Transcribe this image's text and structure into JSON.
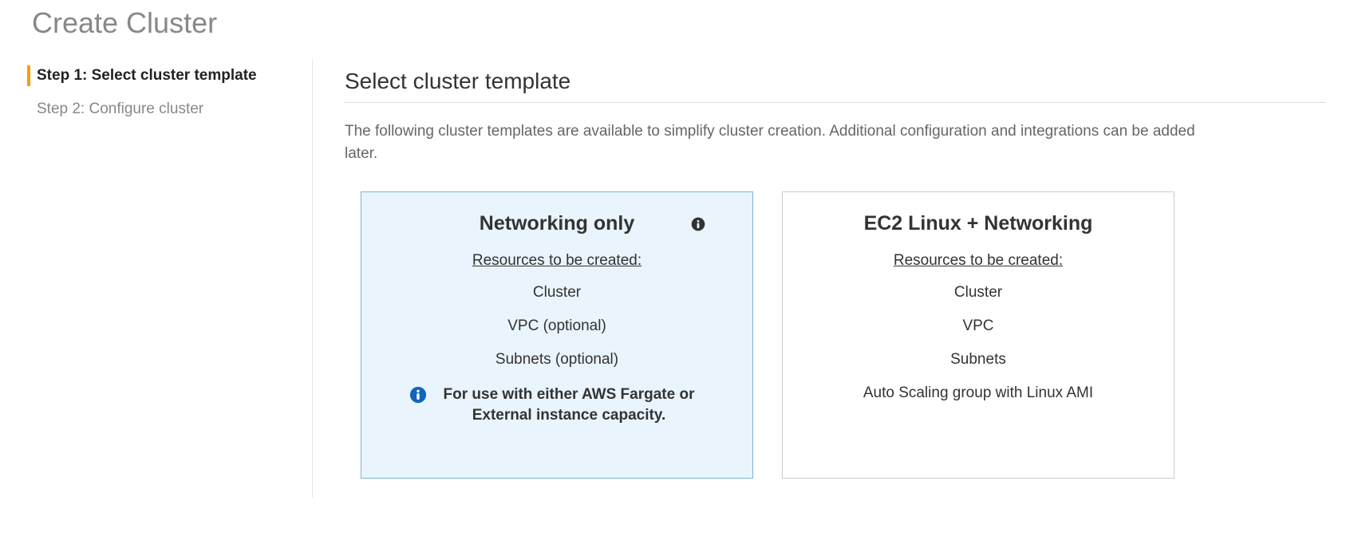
{
  "header": {
    "page_title": "Create Cluster"
  },
  "wizard": {
    "steps": [
      {
        "label": "Step 1: Select cluster template",
        "active": true
      },
      {
        "label": "Step 2: Configure cluster",
        "active": false
      }
    ]
  },
  "section": {
    "title": "Select cluster template",
    "description": "The following cluster templates are available to simplify cluster creation. Additional configuration and integrations can be added later."
  },
  "cards": [
    {
      "title": "Networking only",
      "selected": true,
      "has_top_info_icon": true,
      "resources_label": "Resources to be created:",
      "resources": [
        "Cluster",
        "VPC (optional)",
        "Subnets (optional)"
      ],
      "note_icon": true,
      "note": "For use with either AWS Fargate or External instance capacity."
    },
    {
      "title": "EC2 Linux + Networking",
      "selected": false,
      "has_top_info_icon": false,
      "resources_label": "Resources to be created:",
      "resources": [
        "Cluster",
        "VPC",
        "Subnets",
        "Auto Scaling group with Linux AMI"
      ],
      "note_icon": false,
      "note": ""
    }
  ],
  "colors": {
    "accent": "#ff9900",
    "info_icon": "#1166bb",
    "selected_bg": "#e9f4fc",
    "selected_border": "#7fb3d4"
  }
}
